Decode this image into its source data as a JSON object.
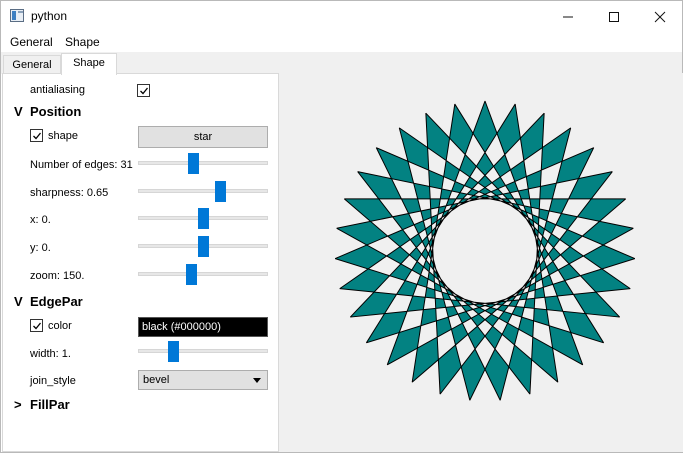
{
  "window": {
    "title": "python"
  },
  "menubar": {
    "items": [
      "General",
      "Shape"
    ]
  },
  "tabs": [
    {
      "label": "General",
      "active": false
    },
    {
      "label": "Shape",
      "active": true
    }
  ],
  "panel": {
    "antialiasing": {
      "label": "antialiasing",
      "checked": true
    },
    "position": {
      "arrow": "V",
      "title": "Position",
      "shape": {
        "label": "shape",
        "checked": true,
        "button_label": "star"
      },
      "edges": {
        "label": "Number of edges: 31",
        "fraction": 0.42
      },
      "sharpness": {
        "label": "sharpness: 0.65",
        "fraction": 0.65
      },
      "x": {
        "label": "x: 0.",
        "fraction": 0.5
      },
      "y": {
        "label": "y: 0.",
        "fraction": 0.5
      },
      "zoom": {
        "label": "zoom: 150.",
        "fraction": 0.4
      }
    },
    "edgepar": {
      "arrow": "V",
      "title": "EdgePar",
      "color": {
        "label": "color",
        "checked": true,
        "value": "black (#000000)"
      },
      "width": {
        "label": "width: 1.",
        "fraction": 0.25
      },
      "join_style": {
        "label": "join_style",
        "value": "bevel"
      }
    },
    "fillpar": {
      "arrow": ">",
      "title": "FillPar"
    }
  },
  "shape": {
    "edges": 31,
    "fill_color": "#038282",
    "edge_color": "#000000"
  }
}
